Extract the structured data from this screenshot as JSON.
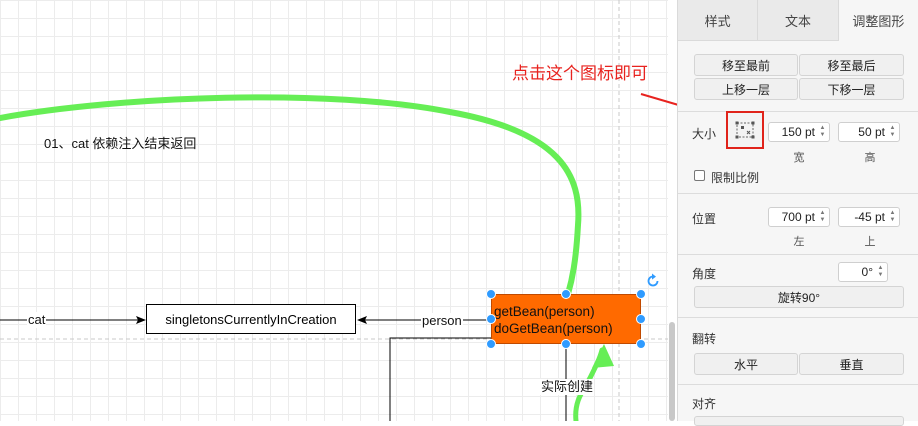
{
  "canvas": {
    "loop_label": "01、cat 依赖注入结束返回",
    "cat_edge_label": "cat",
    "person_edge_label": "person",
    "create_edge_label": "实际创建",
    "singletons_box_text": "singletonsCurrentlyInCreation",
    "getbean_box_lines": [
      "getBean(person)",
      "doGetBean(person)"
    ],
    "getbean_fill": "#ff6a00",
    "highlight_line_color": "#66ee55",
    "selection_handle_color": "#2f9bff",
    "rotate_icon": "rotate-icon"
  },
  "annotation": {
    "text": "点击这个图标即可",
    "color": "#e8231f"
  },
  "panel": {
    "tabs": [
      {
        "label": "样式",
        "active": false
      },
      {
        "label": "文本",
        "active": false
      },
      {
        "label": "调整图形",
        "active": true
      }
    ],
    "arrange": {
      "to_front": "移至最前",
      "to_back": "移至最后",
      "forward": "上移一层",
      "backward": "下移一层"
    },
    "size": {
      "label": "大小",
      "icon": "autosize-icon",
      "width": "150 pt",
      "height": "50 pt",
      "width_label": "宽",
      "height_label": "高",
      "constrain_label": "限制比例",
      "constrain_checked": false
    },
    "position": {
      "label": "位置",
      "left": "700 pt",
      "top": "-45 pt",
      "left_label": "左",
      "top_label": "上"
    },
    "angle": {
      "label": "角度",
      "value": "0°",
      "rotate_button": "旋转90°"
    },
    "flip": {
      "label": "翻转",
      "horizontal": "水平",
      "vertical": "垂直"
    },
    "align": {
      "label": "对齐"
    }
  }
}
